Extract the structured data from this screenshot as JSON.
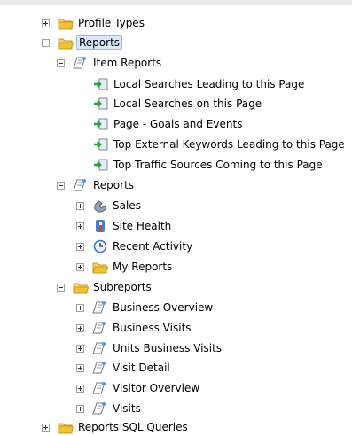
{
  "tree": {
    "profile_types": {
      "label": "Profile Types",
      "icon": "folder-icon"
    },
    "reports": {
      "label": "Reports",
      "icon": "folder-icon",
      "selected": true
    },
    "item_reports": {
      "label": "Item Reports",
      "icon": "report-scroll-icon",
      "children": [
        {
          "label": "Local Searches Leading to this Page",
          "icon": "report-link-icon"
        },
        {
          "label": "Local Searches on this Page",
          "icon": "report-link-icon"
        },
        {
          "label": "Page - Goals and Events",
          "icon": "report-link-icon"
        },
        {
          "label": "Top External Keywords Leading to this Page",
          "icon": "report-link-icon"
        },
        {
          "label": "Top Traffic Sources Coming to this Page",
          "icon": "report-link-icon"
        }
      ]
    },
    "reports_sub": {
      "label": "Reports",
      "icon": "report-scroll-icon",
      "children": [
        {
          "label": "Sales",
          "icon": "telephone-icon"
        },
        {
          "label": "Site Health",
          "icon": "thermometer-icon"
        },
        {
          "label": "Recent Activity",
          "icon": "clock-icon"
        },
        {
          "label": "My Reports",
          "icon": "folder-icon"
        }
      ]
    },
    "subreports": {
      "label": "Subreports",
      "icon": "folder-icon",
      "children": [
        {
          "label": "Business Overview",
          "icon": "report-scroll-icon"
        },
        {
          "label": "Business Visits",
          "icon": "report-scroll-icon"
        },
        {
          "label": "Units Business Visits",
          "icon": "report-scroll-icon"
        },
        {
          "label": "Visit Detail",
          "icon": "report-scroll-icon"
        },
        {
          "label": "Visitor Overview",
          "icon": "report-scroll-icon"
        },
        {
          "label": "Visits",
          "icon": "report-scroll-icon"
        }
      ]
    },
    "reports_sql": {
      "label": "Reports SQL Queries",
      "icon": "folder-icon"
    }
  },
  "colors": {
    "selection_bg": "#dce8f7",
    "selection_border": "#9cb8dc",
    "folder": "#f1c232",
    "link_arrow": "#2e9e3e"
  }
}
